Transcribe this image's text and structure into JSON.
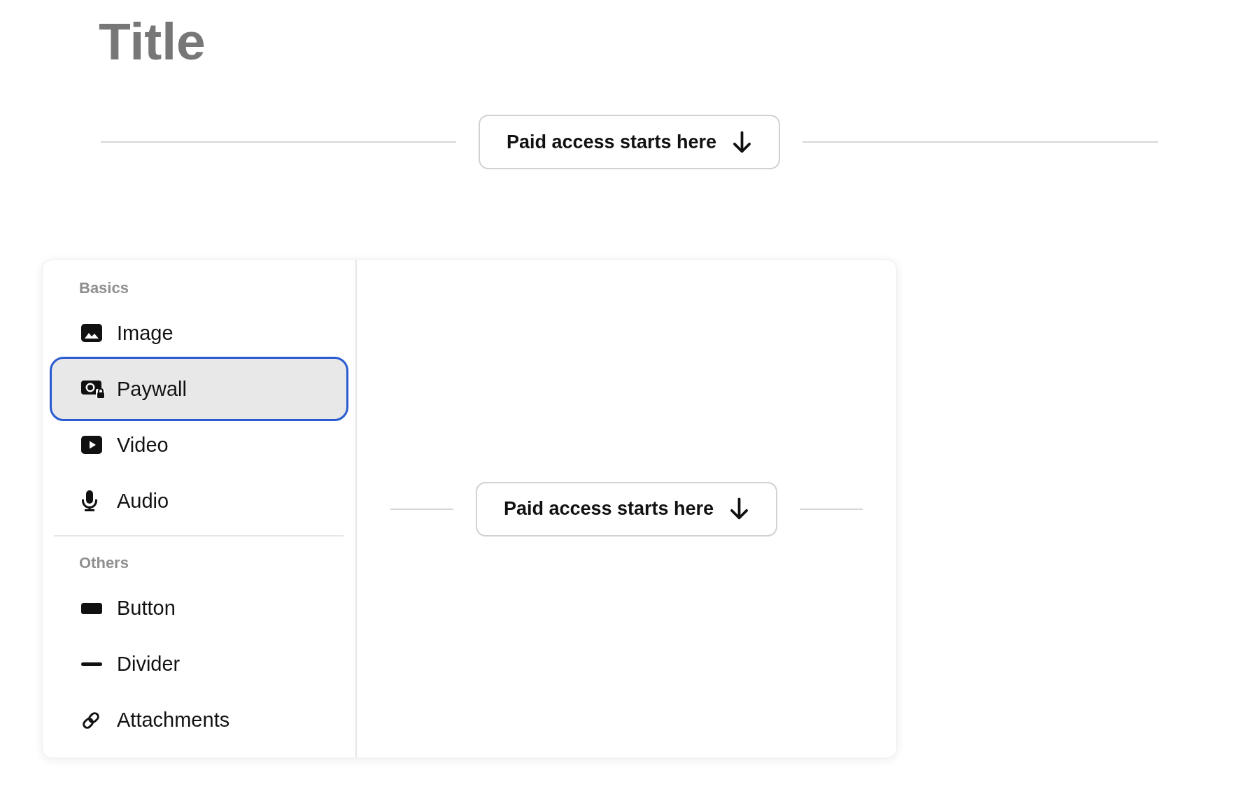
{
  "page": {
    "title": "Title"
  },
  "paywall_marker": {
    "label": "Paid access starts here"
  },
  "insert_menu": {
    "sections": [
      {
        "heading": "Basics",
        "items": [
          {
            "label": "Image",
            "kind": "image",
            "selected": false
          },
          {
            "label": "Paywall",
            "kind": "paywall",
            "selected": true
          },
          {
            "label": "Video",
            "kind": "video",
            "selected": false
          },
          {
            "label": "Audio",
            "kind": "audio",
            "selected": false
          }
        ]
      },
      {
        "heading": "Others",
        "items": [
          {
            "label": "Button",
            "kind": "button",
            "selected": false
          },
          {
            "label": "Divider",
            "kind": "divider",
            "selected": false
          },
          {
            "label": "Attachments",
            "kind": "attachments",
            "selected": false
          }
        ]
      }
    ]
  },
  "preview": {
    "paywall_marker": {
      "label": "Paid access starts here"
    }
  }
}
